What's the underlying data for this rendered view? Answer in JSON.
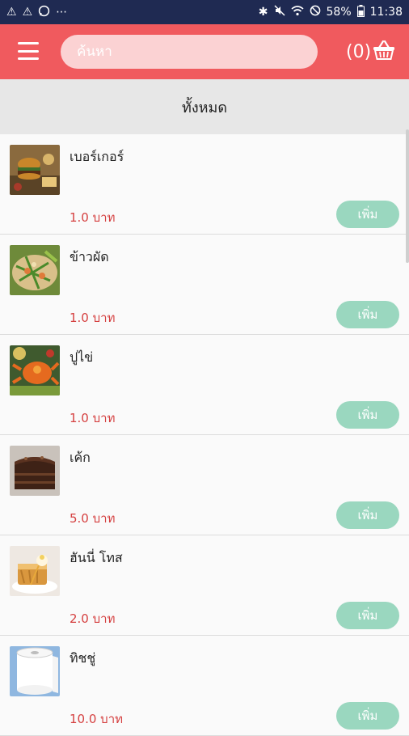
{
  "status_bar": {
    "left_icons": [
      "warning-icon",
      "warning-icon",
      "whatsapp-icon",
      "more-icon"
    ],
    "battery": "58%",
    "time": "11:38"
  },
  "app_bar": {
    "search_placeholder": "ค้นหา",
    "cart_count": "(0)"
  },
  "category": {
    "label": "ทั้งหมด"
  },
  "products": [
    {
      "name": "เบอร์เกอร์",
      "price": "1.0 บาท",
      "add_label": "เพิ่ม",
      "image": "burger-image"
    },
    {
      "name": "ข้าวผัด",
      "price": "1.0 บาท",
      "add_label": "เพิ่ม",
      "image": "fried-rice-image"
    },
    {
      "name": "ปูไข่",
      "price": "1.0 บาท",
      "add_label": "เพิ่ม",
      "image": "crab-image"
    },
    {
      "name": "เค้ก",
      "price": "5.0 บาท",
      "add_label": "เพิ่ม",
      "image": "cake-image"
    },
    {
      "name": "ฮันนี่ โทส",
      "price": "2.0 บาท",
      "add_label": "เพิ่ม",
      "image": "honey-toast-image"
    },
    {
      "name": "ทิชชู่",
      "price": "10.0 บาท",
      "add_label": "เพิ่ม",
      "image": "tissue-image"
    }
  ],
  "colors": {
    "status_bar": "#1f2a52",
    "app_bar": "#f05a5e",
    "search_bg": "#fbd2d3",
    "price": "#d54040",
    "add_button": "#9ad7bf"
  }
}
